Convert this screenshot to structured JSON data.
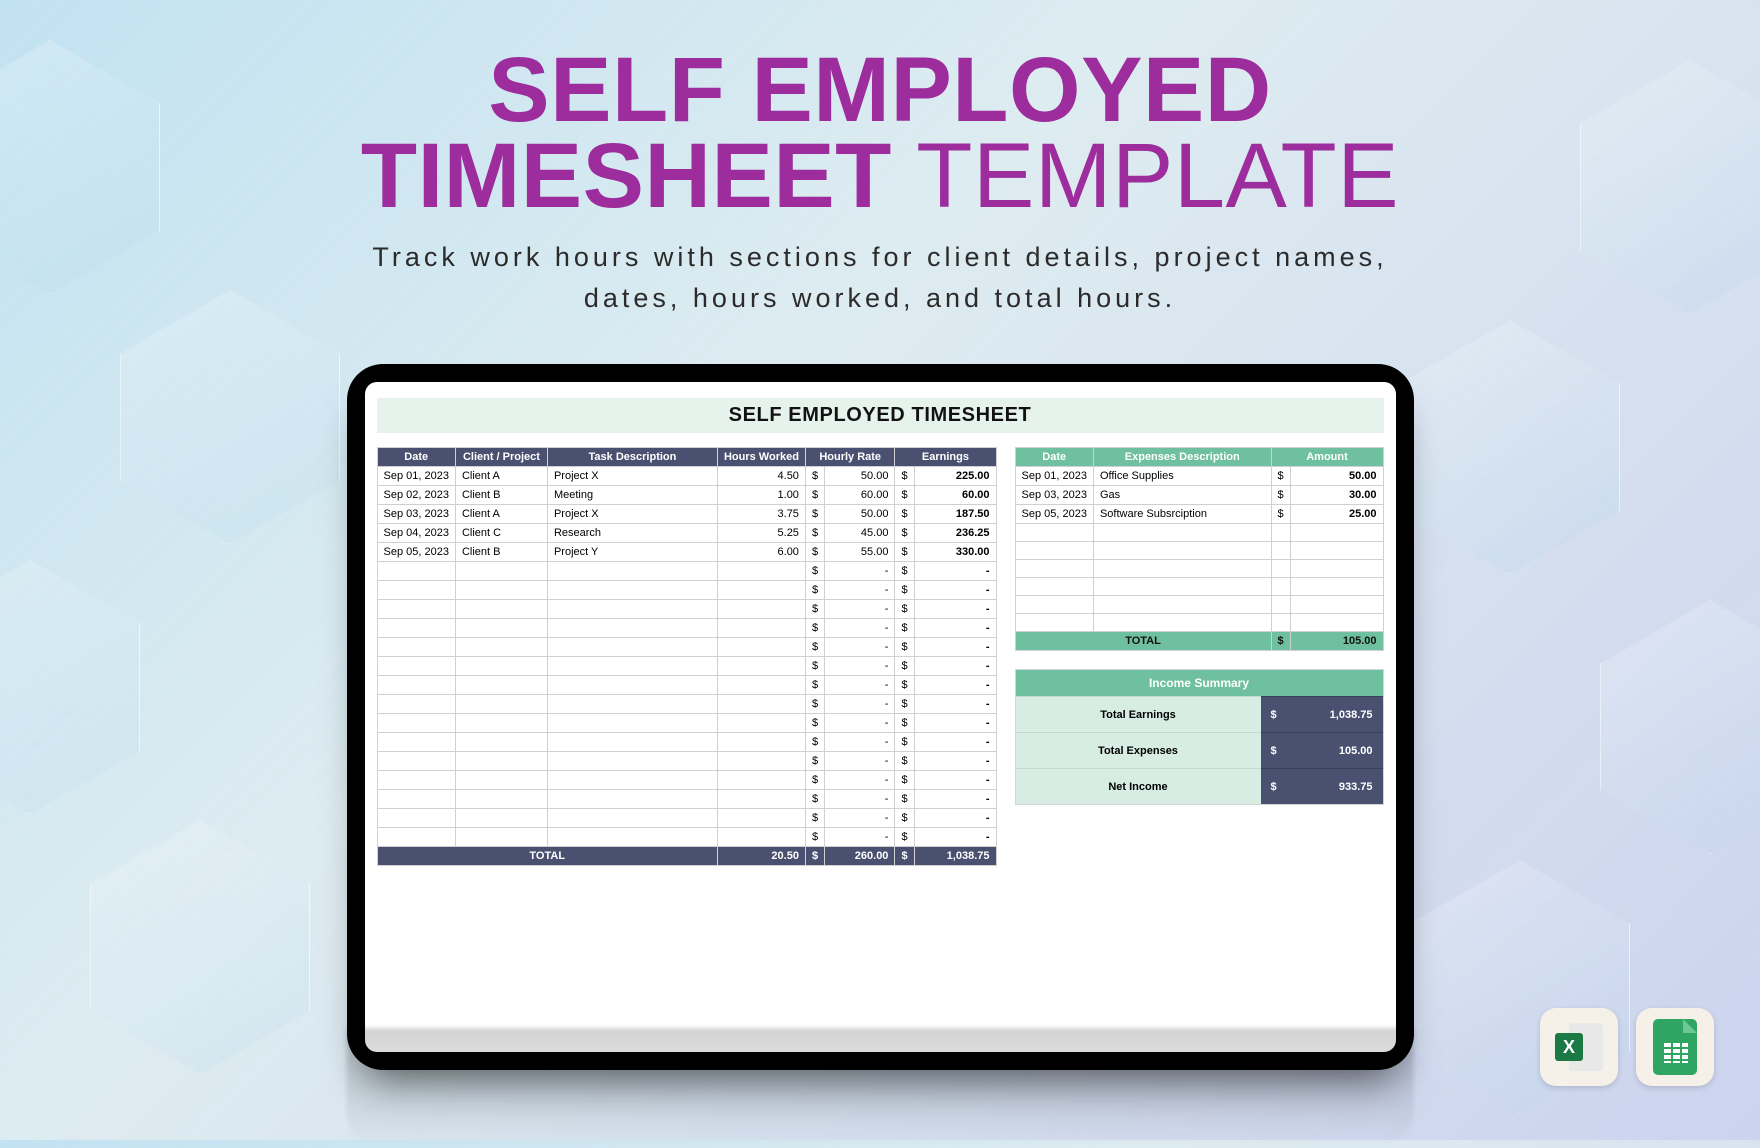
{
  "hero": {
    "title_line1": "SELF EMPLOYED",
    "title_line2a": "TIMESHEET",
    "title_line2b": " TEMPLATE",
    "subtitle_l1": "Track work hours with sections for client details, project names,",
    "subtitle_l2": "dates, hours worked, and total hours."
  },
  "sheet": {
    "title": "SELF EMPLOYED TIMESHEET",
    "timesheet": {
      "headers": [
        "Date",
        "Client / Project",
        "Task Description",
        "Hours Worked",
        "Hourly Rate",
        "Earnings"
      ],
      "rows": [
        {
          "date": "Sep 01, 2023",
          "client": "Client A",
          "task": "Project X",
          "hours": "4.50",
          "rate": "50.00",
          "earn": "225.00"
        },
        {
          "date": "Sep 02, 2023",
          "client": "Client B",
          "task": "Meeting",
          "hours": "1.00",
          "rate": "60.00",
          "earn": "60.00"
        },
        {
          "date": "Sep 03, 2023",
          "client": "Client A",
          "task": "Project X",
          "hours": "3.75",
          "rate": "50.00",
          "earn": "187.50"
        },
        {
          "date": "Sep 04, 2023",
          "client": "Client C",
          "task": "Research",
          "hours": "5.25",
          "rate": "45.00",
          "earn": "236.25"
        },
        {
          "date": "Sep 05, 2023",
          "client": "Client B",
          "task": "Project Y",
          "hours": "6.00",
          "rate": "55.00",
          "earn": "330.00"
        }
      ],
      "empty_rows": 15,
      "total_label": "TOTAL",
      "total_hours": "20.50",
      "total_rate": "260.00",
      "total_earn": "1,038.75"
    },
    "expenses": {
      "headers": [
        "Date",
        "Expenses Description",
        "Amount"
      ],
      "rows": [
        {
          "date": "Sep 01, 2023",
          "desc": "Office Supplies",
          "amt": "50.00"
        },
        {
          "date": "Sep 03, 2023",
          "desc": "Gas",
          "amt": "30.00"
        },
        {
          "date": "Sep 05, 2023",
          "desc": "Software Subsrciption",
          "amt": "25.00"
        }
      ],
      "empty_rows": 6,
      "total_label": "TOTAL",
      "total": "105.00"
    },
    "summary": {
      "title": "Income Summary",
      "rows": [
        {
          "label": "Total Earnings",
          "value": "1,038.75"
        },
        {
          "label": "Total Expenses",
          "value": "105.00"
        },
        {
          "label": "Net Income",
          "value": "933.75"
        }
      ]
    }
  },
  "currency": "$",
  "dash": "-",
  "icons": {
    "excel": "X"
  }
}
